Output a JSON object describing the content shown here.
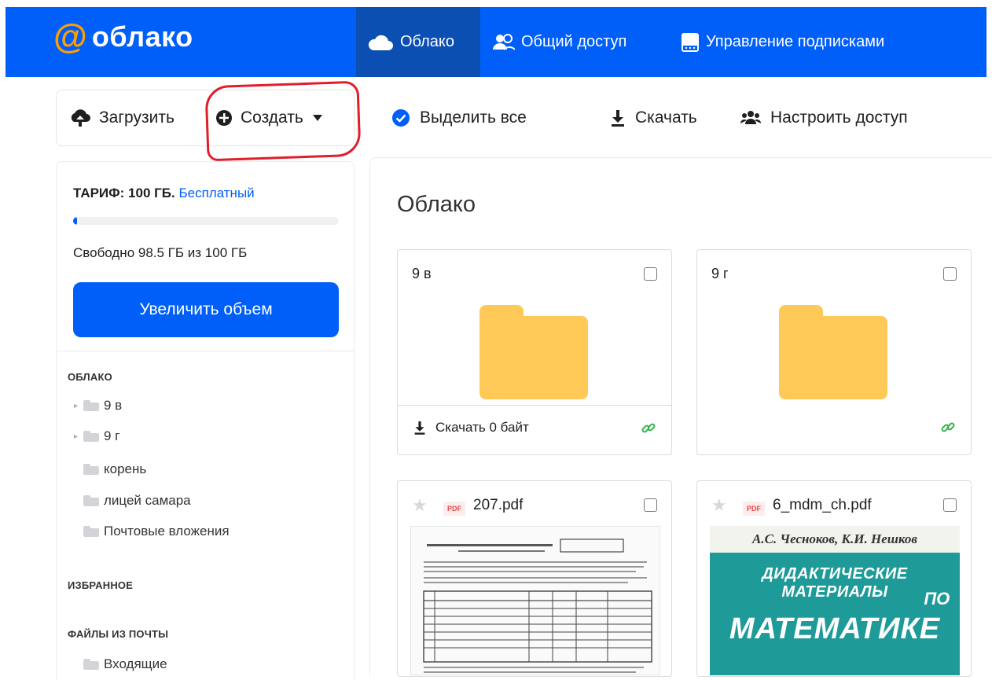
{
  "brand": {
    "at": "@",
    "name": "облако"
  },
  "nav": [
    {
      "label": "Облако",
      "icon": "cloud-icon",
      "active": true
    },
    {
      "label": "Общий доступ",
      "icon": "people-icon"
    },
    {
      "label": "Управление подписками",
      "icon": "subscription-icon"
    }
  ],
  "toolbar": {
    "upload_label": "Загрузить",
    "create_label": "Создать",
    "select_all_label": "Выделить все",
    "download_label": "Скачать",
    "share_label": "Настроить доступ"
  },
  "storage": {
    "tariff_prefix": "ТАРИФ: 100 ГБ.",
    "plan_name": "Бесплатный",
    "used_fraction": 0.015,
    "free_text": "Свободно 98.5 ГБ из 100 ГБ",
    "upgrade_label": "Увеличить объем"
  },
  "sidebar": {
    "cloud_title": "ОБЛАКО",
    "cloud_items": [
      {
        "label": "9 в",
        "expandable": true
      },
      {
        "label": "9 г",
        "expandable": true
      },
      {
        "label": "корень",
        "expandable": false
      },
      {
        "label": "лицей самара",
        "expandable": false
      },
      {
        "label": "Почтовые вложения",
        "expandable": false
      }
    ],
    "favorites_title": "ИЗБРАННОЕ",
    "mail_title": "ФАЙЛЫ ИЗ ПОЧТЫ",
    "mail_items": [
      {
        "label": "Входящие"
      }
    ]
  },
  "main": {
    "title": "Облако",
    "folders": [
      {
        "name": "9 в",
        "download_label": "Скачать 0 байт"
      },
      {
        "name": "9 г"
      }
    ],
    "files": [
      {
        "name": "207.pdf",
        "type_badge": "PDF"
      },
      {
        "name": "6_mdm_ch.pdf",
        "type_badge": "PDF",
        "cover": {
          "authors": "А.С. Чесноков, К.И. Нешков",
          "line1": "ДИДАКТИЧЕСКИЕ МАТЕРИАЛЫ",
          "line2": "ПО",
          "line3": "МАТЕМАТИКЕ"
        }
      }
    ]
  },
  "colors": {
    "brand_blue": "#005ff9",
    "folder_yellow": "#ffc957",
    "annotation_red": "#e01e2b",
    "link_green": "#2fb344"
  }
}
